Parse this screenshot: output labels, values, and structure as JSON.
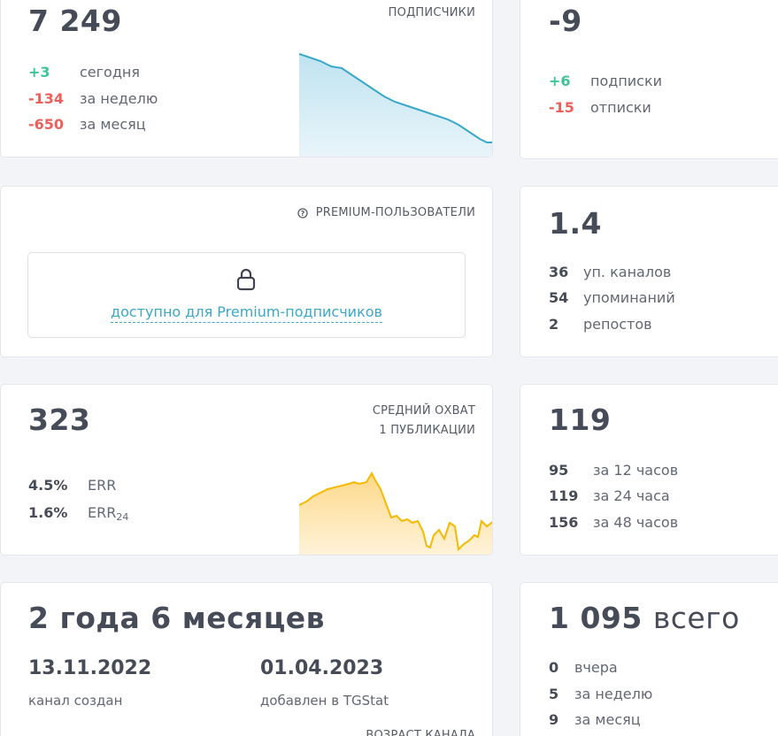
{
  "subscribers": {
    "total": "7 249",
    "caption": "ПОДПИСЧИКИ",
    "rows": [
      {
        "value": "+3",
        "label": "сегодня",
        "tone": "green"
      },
      {
        "value": "-134",
        "label": "за неделю",
        "tone": "red"
      },
      {
        "value": "-650",
        "label": "за месяц",
        "tone": "red"
      }
    ],
    "chart_color": "#3aa8c8"
  },
  "net_change": {
    "total": "-9",
    "rows": [
      {
        "value": "+6",
        "label": "подписки",
        "tone": "green"
      },
      {
        "value": "-15",
        "label": "отписки",
        "tone": "red"
      }
    ]
  },
  "premium": {
    "caption": "PREMIUM-ПОЛЬЗОВАТЕЛИ",
    "icon": "question-circle-icon",
    "lock_icon": "lock-icon",
    "link_text": "доступно для Premium-подписчиков"
  },
  "citation": {
    "total": "1.4",
    "rows": [
      {
        "value": "36",
        "label": "уп. каналов"
      },
      {
        "value": "54",
        "label": "упоминаний"
      },
      {
        "value": "2",
        "label": "репостов"
      }
    ]
  },
  "reach": {
    "total": "323",
    "caption_line1": "СРЕДНИЙ ОХВАТ",
    "caption_line2": "1 ПУБЛИКАЦИИ",
    "rows": [
      {
        "value": "4.5%",
        "label": "ERR"
      },
      {
        "value": "1.6%",
        "label": "ERR",
        "sub": "24"
      }
    ],
    "chart_color": "#f5b900"
  },
  "views": {
    "total": "119",
    "rows": [
      {
        "value": "95",
        "label": "за 12 часов"
      },
      {
        "value": "119",
        "label": "за 24 часа"
      },
      {
        "value": "156",
        "label": "за 48 часов"
      }
    ]
  },
  "age": {
    "total": "2 года 6 месяцев",
    "created_date": "13.11.2022",
    "created_label": "канал создан",
    "added_date": "01.04.2023",
    "added_label": "добавлен в TGStat",
    "caption": "ВОЗРАСТ КАНАЛА"
  },
  "posts": {
    "total": "1 095",
    "total_suffix": "всего",
    "rows": [
      {
        "value": "0",
        "label": "вчера"
      },
      {
        "value": "5",
        "label": "за неделю"
      },
      {
        "value": "9",
        "label": "за месяц"
      }
    ]
  }
}
